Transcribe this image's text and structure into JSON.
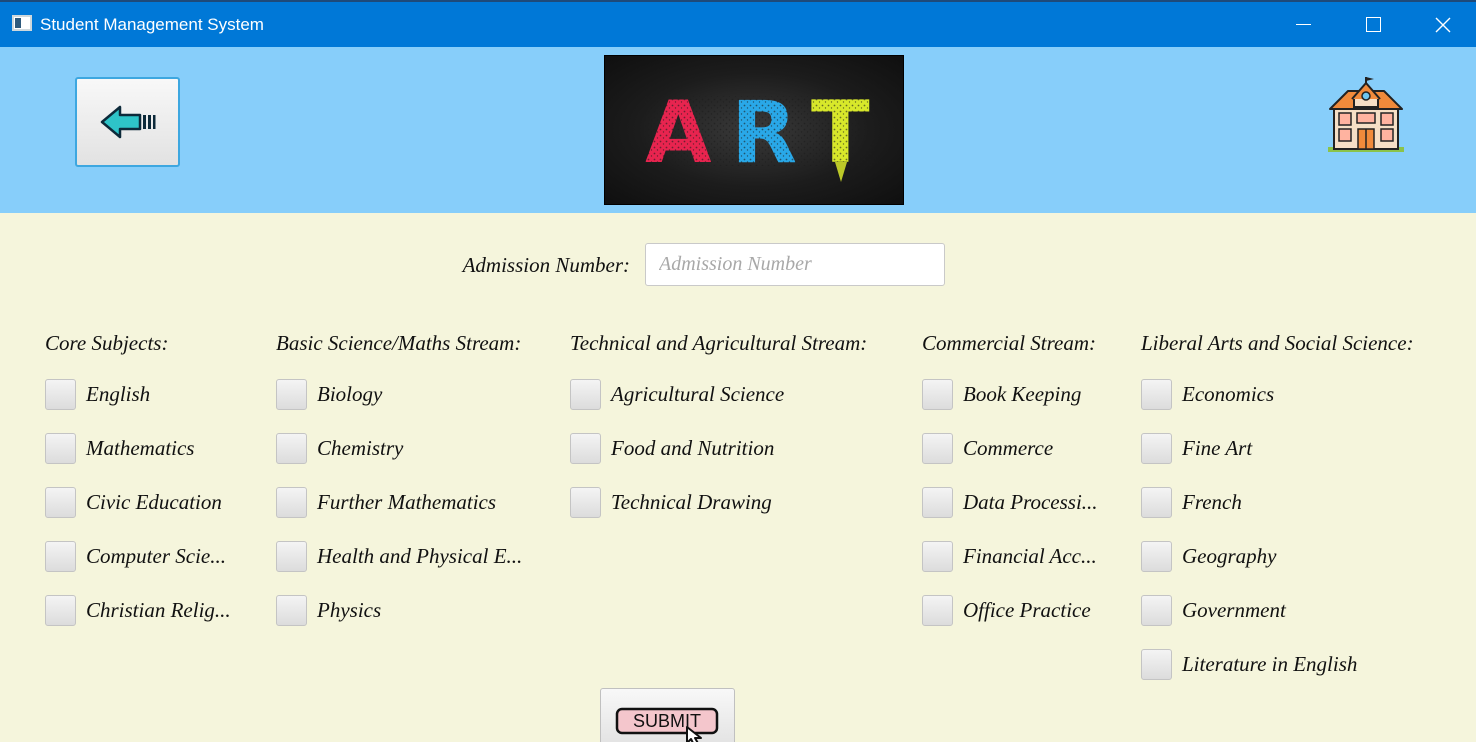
{
  "window": {
    "title": "Student Management System",
    "minimize_icon": "minimize-icon",
    "maximize_icon": "maximize-icon",
    "close_icon": "close-icon"
  },
  "header": {
    "back_icon": "back-arrow-icon",
    "banner_text": "ART",
    "banner_colors": [
      "#e8244f",
      "#29a8e8",
      "#d8e82a"
    ],
    "school_icon": "school-building-icon",
    "background": "#87cefa"
  },
  "form": {
    "admission_label": "Admission Number:",
    "admission_placeholder": "Admission Number",
    "admission_value": ""
  },
  "columns": [
    {
      "header": "Core Subjects:",
      "items": [
        {
          "label": "English",
          "checked": false
        },
        {
          "label": "Mathematics",
          "checked": false
        },
        {
          "label": "Civic Education",
          "checked": false
        },
        {
          "label": "Computer Scie...",
          "checked": false
        },
        {
          "label": "Christian Relig...",
          "checked": false
        }
      ]
    },
    {
      "header": "Basic Science/Maths Stream:",
      "items": [
        {
          "label": "Biology",
          "checked": false
        },
        {
          "label": "Chemistry",
          "checked": false
        },
        {
          "label": "Further Mathematics",
          "checked": false
        },
        {
          "label": "Health and Physical E...",
          "checked": false
        },
        {
          "label": "Physics",
          "checked": false
        }
      ]
    },
    {
      "header": "Technical and Agricultural Stream:",
      "items": [
        {
          "label": "Agricultural Science",
          "checked": false
        },
        {
          "label": "Food and Nutrition",
          "checked": false
        },
        {
          "label": "Technical Drawing",
          "checked": false
        }
      ]
    },
    {
      "header": "Commercial Stream:",
      "items": [
        {
          "label": "Book Keeping",
          "checked": false
        },
        {
          "label": "Commerce",
          "checked": false
        },
        {
          "label": "Data Processi...",
          "checked": false
        },
        {
          "label": "Financial Acc...",
          "checked": false
        },
        {
          "label": "Office Practice",
          "checked": false
        }
      ]
    },
    {
      "header": "Liberal Arts and Social Science:",
      "items": [
        {
          "label": "Economics",
          "checked": false
        },
        {
          "label": "Fine Art",
          "checked": false
        },
        {
          "label": "French",
          "checked": false
        },
        {
          "label": "Geography",
          "checked": false
        },
        {
          "label": "Government",
          "checked": false
        },
        {
          "label": "Literature in English",
          "checked": false
        }
      ]
    }
  ],
  "submit": {
    "label": "SUBMIT",
    "icon": "pointer-hand-icon",
    "fill_color": "#f4c6cc"
  }
}
